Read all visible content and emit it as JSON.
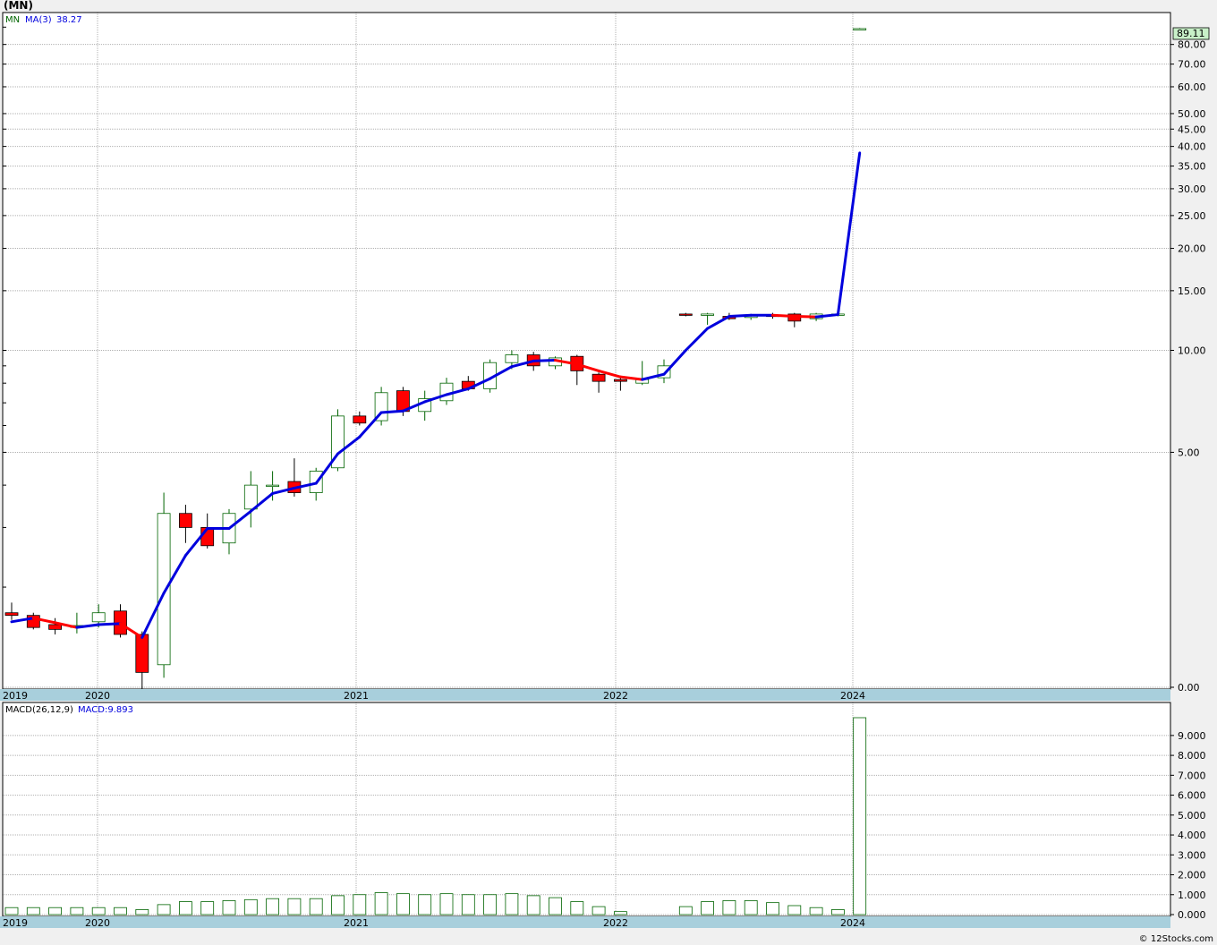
{
  "ticker": "(MN)",
  "watermark": "© 12Stocks.com",
  "colors": {
    "up_candle": "#006400",
    "down_candle": "#ff0000",
    "ma_up": "#0000dd",
    "ma_down": "#ff0000",
    "year_band": "#a8cfdc",
    "grid": "#b0b0b0",
    "price_badge": "#c8f0c8"
  },
  "chart_data": [
    {
      "type": "candlestick",
      "title": "(MN)",
      "scale": "log",
      "legend": {
        "symbol": "MN",
        "ma_label": "MA(3)",
        "ma_value": "38.27"
      },
      "last_price_label": "89.11",
      "y_ticks": [
        "80.00",
        "70.00",
        "60.00",
        "50.00",
        "45.00",
        "40.00",
        "35.00",
        "30.00",
        "25.00",
        "20.00",
        "15.00",
        "10.00",
        "5.00",
        "0.00"
      ],
      "x_year_labels": [
        "2019",
        "2020",
        "2021",
        "2022",
        "2024"
      ],
      "candles": [
        {
          "o": 1.68,
          "h": 1.8,
          "l": 1.6,
          "c": 1.65
        },
        {
          "o": 1.65,
          "h": 1.68,
          "l": 1.5,
          "c": 1.52
        },
        {
          "o": 1.55,
          "h": 1.62,
          "l": 1.45,
          "c": 1.5
        },
        {
          "o": 1.52,
          "h": 1.68,
          "l": 1.46,
          "c": 1.54
        },
        {
          "o": 1.58,
          "h": 1.78,
          "l": 1.52,
          "c": 1.68
        },
        {
          "o": 1.7,
          "h": 1.78,
          "l": 1.42,
          "c": 1.45
        },
        {
          "o": 1.45,
          "h": 1.48,
          "l": 1.0,
          "c": 1.12
        },
        {
          "o": 1.18,
          "h": 3.8,
          "l": 1.08,
          "c": 3.3
        },
        {
          "o": 3.3,
          "h": 3.5,
          "l": 2.7,
          "c": 3.0
        },
        {
          "o": 3.0,
          "h": 3.3,
          "l": 2.6,
          "c": 2.65
        },
        {
          "o": 2.7,
          "h": 3.4,
          "l": 2.5,
          "c": 3.3
        },
        {
          "o": 3.4,
          "h": 4.4,
          "l": 3.0,
          "c": 4.0
        },
        {
          "o": 4.0,
          "h": 4.4,
          "l": 3.6,
          "c": 4.0
        },
        {
          "o": 4.1,
          "h": 4.8,
          "l": 3.7,
          "c": 3.8
        },
        {
          "o": 3.8,
          "h": 4.5,
          "l": 3.6,
          "c": 4.4
        },
        {
          "o": 4.5,
          "h": 6.7,
          "l": 4.4,
          "c": 6.4
        },
        {
          "o": 6.4,
          "h": 6.6,
          "l": 6.0,
          "c": 6.1
        },
        {
          "o": 6.2,
          "h": 7.8,
          "l": 6.0,
          "c": 7.5
        },
        {
          "o": 7.6,
          "h": 7.8,
          "l": 6.4,
          "c": 6.6
        },
        {
          "o": 6.6,
          "h": 7.6,
          "l": 6.2,
          "c": 7.2
        },
        {
          "o": 7.1,
          "h": 8.3,
          "l": 6.9,
          "c": 8.0
        },
        {
          "o": 8.1,
          "h": 8.4,
          "l": 7.6,
          "c": 7.7
        },
        {
          "o": 7.7,
          "h": 9.4,
          "l": 7.5,
          "c": 9.2
        },
        {
          "o": 9.2,
          "h": 10.0,
          "l": 8.8,
          "c": 9.7
        },
        {
          "o": 9.7,
          "h": 9.9,
          "l": 8.7,
          "c": 9.0
        },
        {
          "o": 9.0,
          "h": 9.6,
          "l": 8.8,
          "c": 9.5
        },
        {
          "o": 9.6,
          "h": 9.7,
          "l": 7.9,
          "c": 8.7
        },
        {
          "o": 8.5,
          "h": 8.6,
          "l": 7.5,
          "c": 8.1
        },
        {
          "o": 8.2,
          "h": 8.3,
          "l": 7.6,
          "c": 8.1
        },
        {
          "o": 8.0,
          "h": 9.3,
          "l": 7.9,
          "c": 8.2
        },
        {
          "o": 8.3,
          "h": 9.4,
          "l": 8.0,
          "c": 9.0
        },
        {
          "o": 12.8,
          "h": 12.9,
          "l": 12.6,
          "c": 12.7
        },
        {
          "o": 12.8,
          "h": 12.9,
          "l": 11.9,
          "c": 12.8
        },
        {
          "o": 12.6,
          "h": 12.9,
          "l": 12.3,
          "c": 12.4
        },
        {
          "o": 12.5,
          "h": 12.8,
          "l": 12.3,
          "c": 12.7
        },
        {
          "o": 12.7,
          "h": 12.9,
          "l": 12.4,
          "c": 12.6
        },
        {
          "o": 12.8,
          "h": 12.9,
          "l": 11.7,
          "c": 12.2
        },
        {
          "o": 12.4,
          "h": 12.9,
          "l": 12.2,
          "c": 12.8
        },
        {
          "o": 12.8,
          "h": 12.9,
          "l": 12.6,
          "c": 12.8
        },
        {
          "o": 89.0,
          "h": 89.5,
          "l": 88.5,
          "c": 89.11
        }
      ],
      "ma": [
        1.58,
        1.62,
        1.57,
        1.52,
        1.55,
        1.56,
        1.42,
        1.92,
        2.48,
        2.98,
        2.98,
        3.35,
        3.78,
        3.92,
        4.05,
        4.95,
        5.55,
        6.55,
        6.62,
        7.05,
        7.4,
        7.7,
        8.25,
        8.95,
        9.3,
        9.35,
        9.1,
        8.7,
        8.35,
        8.2,
        8.5,
        10.0,
        11.6,
        12.6,
        12.7,
        12.7,
        12.6,
        12.55,
        12.75,
        38.27
      ]
    },
    {
      "type": "bar",
      "title": "MACD(26,12,9)",
      "legend": {
        "label": "MACD(26,12,9)",
        "value_label": "MACD:9.893"
      },
      "y_ticks": [
        "9.000",
        "8.000",
        "7.000",
        "6.000",
        "5.000",
        "4.000",
        "3.000",
        "2.000",
        "1.000",
        "0.000"
      ],
      "ylim": [
        0,
        10.3
      ],
      "x_year_labels": [
        "2019",
        "2020",
        "2021",
        "2022",
        "2024"
      ],
      "values": [
        0.35,
        0.35,
        0.35,
        0.35,
        0.35,
        0.35,
        0.25,
        0.5,
        0.65,
        0.65,
        0.7,
        0.75,
        0.8,
        0.8,
        0.8,
        0.95,
        1.0,
        1.1,
        1.05,
        1.0,
        1.05,
        1.0,
        1.0,
        1.05,
        0.95,
        0.85,
        0.65,
        0.4,
        0.15,
        0,
        0,
        0.4,
        0.65,
        0.7,
        0.7,
        0.6,
        0.45,
        0.35,
        0.25,
        9.893
      ]
    }
  ]
}
